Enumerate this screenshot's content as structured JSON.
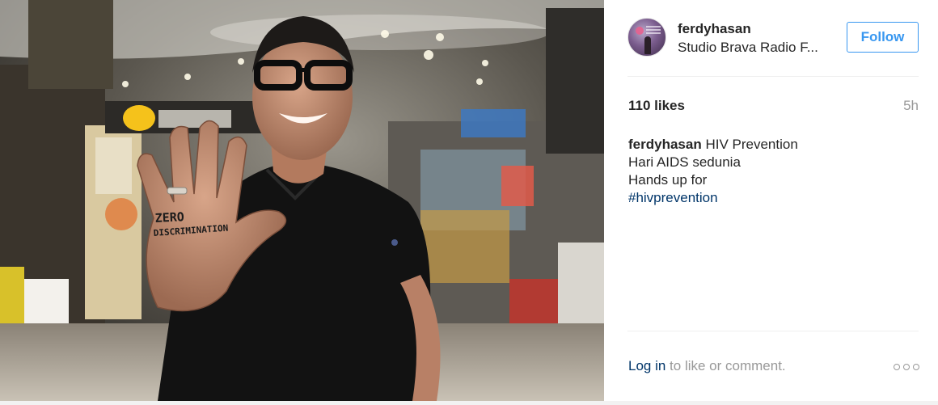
{
  "post": {
    "photo": {
      "description_icon": "photo-of-man-showing-hand",
      "hand_text_line1": "ZERO",
      "hand_text_line2": "DISCRIMINATION"
    },
    "author": {
      "username": "ferdyhasan",
      "location": "Studio Brava Radio F..."
    },
    "follow_label": "Follow",
    "likes": "110 likes",
    "time": "5h",
    "caption": {
      "username": "ferdyhasan",
      "line1": "HIV Prevention",
      "line2": "Hari AIDS sedunia",
      "line3": "Hands up for",
      "hashtag": "#hivprevention"
    },
    "footer": {
      "login_link": "Log in",
      "login_rest": " to like or comment.",
      "more_icon": "more-options-icon"
    }
  },
  "colors": {
    "accent": "#3897f0",
    "link": "#003569",
    "muted": "#999999",
    "text": "#262626"
  }
}
